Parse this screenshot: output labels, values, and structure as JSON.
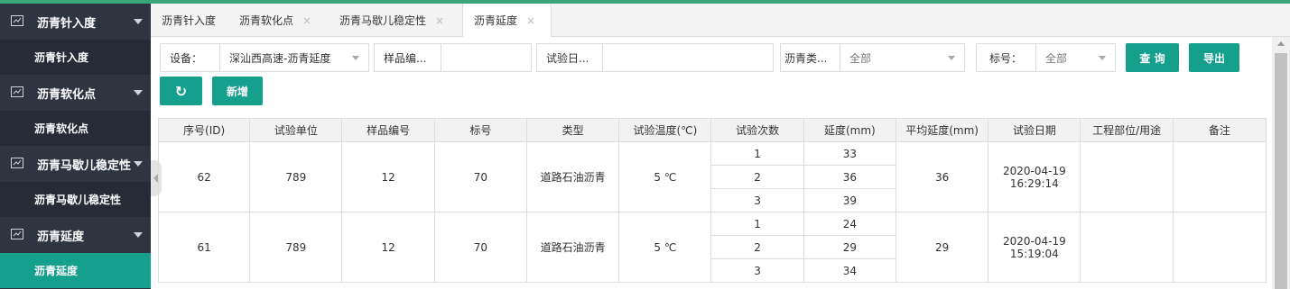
{
  "colors": {
    "accent": "#159f8d",
    "sidebar_bg": "#2e3440",
    "top_line": "#3aa57a"
  },
  "sidebar": {
    "groups": [
      {
        "label": "沥青针入度",
        "icon": "chart-icon",
        "sub": "沥青针入度"
      },
      {
        "label": "沥青软化点",
        "icon": "chart-icon",
        "sub": "沥青软化点"
      },
      {
        "label": "沥青马歇儿稳定性",
        "icon": "chart-icon",
        "sub": "沥青马歇儿稳定性"
      },
      {
        "label": "沥青延度",
        "icon": "chart-icon",
        "sub": "沥青延度"
      }
    ]
  },
  "tabs": [
    {
      "label": "沥青针入度",
      "close": ""
    },
    {
      "label": "沥青软化点",
      "close": "×"
    },
    {
      "label": "沥青马歇儿稳定性",
      "close": "×"
    },
    {
      "label": "沥青延度",
      "close": "×"
    }
  ],
  "filters": {
    "device_label": "设备：",
    "device_value": "深汕西高速-沥青延度",
    "sample_label": "样品编...",
    "sample_value": "",
    "date_label": "试验日...",
    "date_value": "",
    "type_label": "沥青类...",
    "type_value": "全部",
    "mark_label": "标号：",
    "mark_value": "全部"
  },
  "buttons": {
    "query": "查 询",
    "export": "导出",
    "refresh_icon": "↻",
    "add": "新增"
  },
  "table": {
    "headers": [
      "序号(ID)",
      "试验单位",
      "样品编号",
      "标号",
      "类型",
      "试验温度(℃)",
      "试验次数",
      "延度(mm)",
      "平均延度(mm)",
      "试验日期",
      "工程部位/用途",
      "备注"
    ],
    "rows": [
      {
        "id": "62",
        "unit": "789",
        "sample": "12",
        "mark": "70",
        "type": "道路石油沥青",
        "temp": "5 ℃",
        "trials": [
          {
            "n": "1",
            "d": "33"
          },
          {
            "n": "2",
            "d": "36"
          },
          {
            "n": "3",
            "d": "39"
          }
        ],
        "avg": "36",
        "date": "2020-04-19",
        "time": "16:29:14",
        "part": "",
        "note": ""
      },
      {
        "id": "61",
        "unit": "789",
        "sample": "12",
        "mark": "70",
        "type": "道路石油沥青",
        "temp": "5 ℃",
        "trials": [
          {
            "n": "1",
            "d": "24"
          },
          {
            "n": "2",
            "d": "29"
          },
          {
            "n": "3",
            "d": "34"
          }
        ],
        "avg": "29",
        "date": "2020-04-19",
        "time": "15:19:04",
        "part": "",
        "note": ""
      }
    ]
  }
}
